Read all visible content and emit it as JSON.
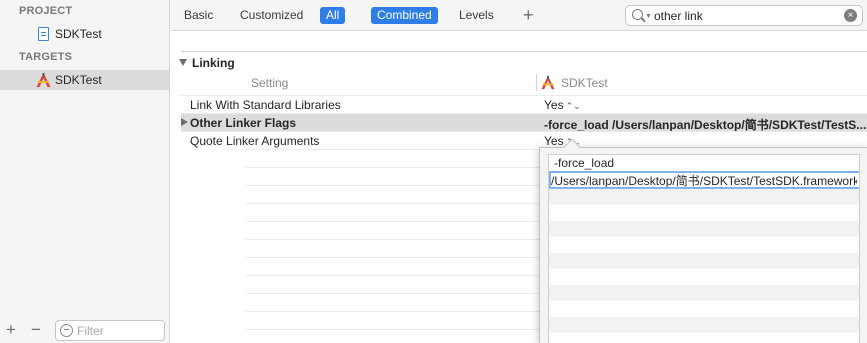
{
  "sidebar": {
    "project_header": "PROJECT",
    "project_item": "SDKTest",
    "targets_header": "TARGETS",
    "target_item": "SDKTest",
    "filter_placeholder": "Filter",
    "add_label": "+",
    "remove_label": "−"
  },
  "toolbar": {
    "basic": "Basic",
    "customized": "Customized",
    "all": "All",
    "combined": "Combined",
    "levels": "Levels",
    "add": "+",
    "search_value": "other link"
  },
  "settings": {
    "section_title": "Linking",
    "col_setting": "Setting",
    "col_target": "SDKTest",
    "rows": [
      {
        "name": "Link With Standard Libraries",
        "value": "Yes"
      },
      {
        "name": "Other Linker Flags",
        "value": "-force_load /Users/lanpan/Desktop/简书/SDKTest/TestS..."
      },
      {
        "name": "Quote Linker Arguments",
        "value": "Yes"
      }
    ],
    "stepper_glyph": "⌃⌄"
  },
  "popover": {
    "items": [
      "-force_load",
      "/Users/lanpan/Desktop/简书/SDKTest/TestSDK.framework/TestSDK"
    ]
  },
  "colors": {
    "accent": "#2f7ee8",
    "selection": "#dcdcdc",
    "sidebar_bg": "#f5f5f5",
    "target_icon_red": "#d9443a",
    "target_icon_yellow": "#f0b429"
  }
}
